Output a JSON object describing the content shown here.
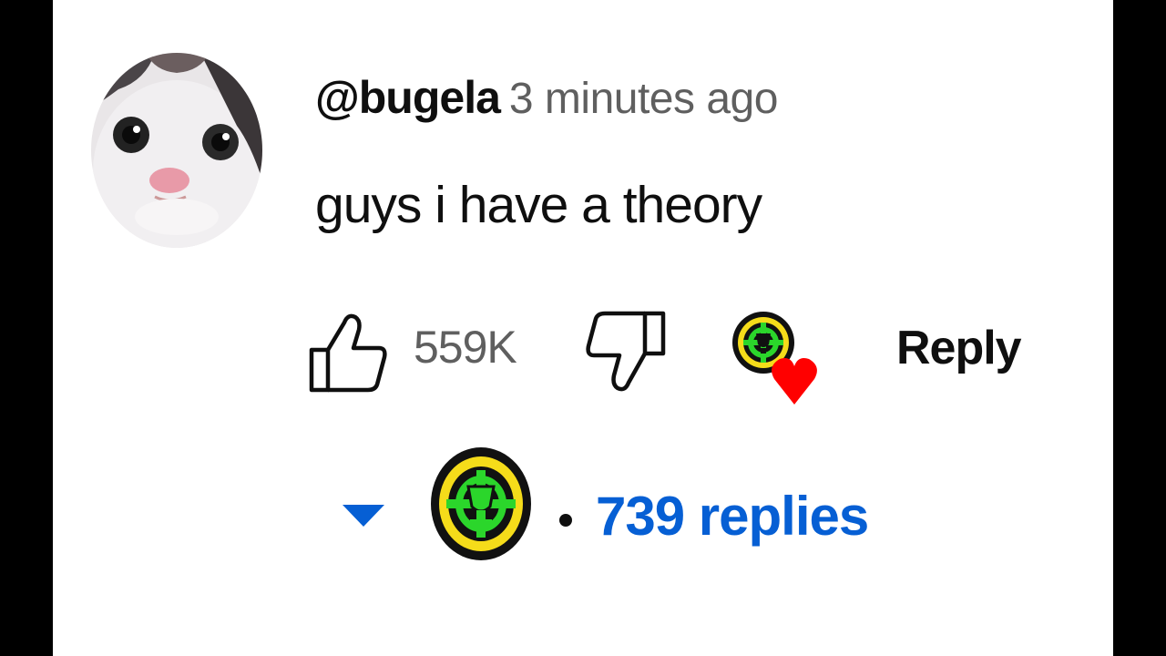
{
  "comment": {
    "author": "@bugela",
    "time": "3 minutes ago",
    "text": "guys i have a theory",
    "likes": "559K",
    "reply_label": "Reply",
    "replies": "739 replies"
  },
  "icons": {
    "like": "thumbs-up-icon",
    "dislike": "thumbs-down-icon",
    "creator_heart": "creator-heart-icon",
    "expand": "caret-down-icon"
  },
  "colors": {
    "background": "#ffffff",
    "text": "#0f0f0f",
    "secondary": "#5f5f5f",
    "link": "#065fd4",
    "heart": "#ff0000",
    "badge_yellow": "#f5dc1a",
    "badge_green": "#2bd62b"
  }
}
